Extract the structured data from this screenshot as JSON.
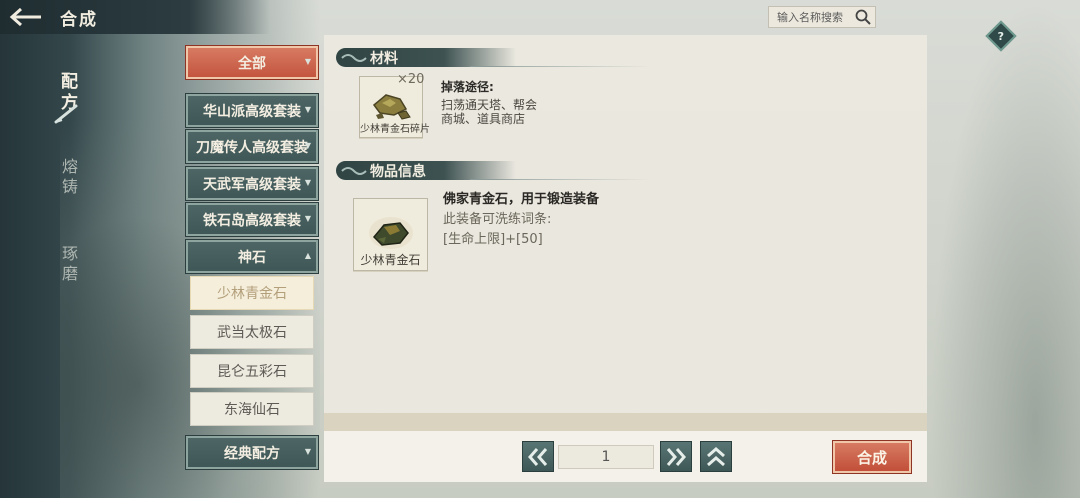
{
  "header": {
    "title": "合成",
    "back_icon": "back-arrow-icon",
    "search_placeholder": "输入名称搜索",
    "help_label": "?"
  },
  "side_tabs": [
    {
      "label": "配方",
      "active": true
    },
    {
      "label": "熔铸",
      "active": false
    },
    {
      "label": "琢磨",
      "active": false
    }
  ],
  "categories": {
    "all": "全部",
    "cat1": "华山派高级套装",
    "cat2": "刀魔传人高级套装",
    "cat3": "天武军高级套装",
    "cat4": "铁石岛高级套装",
    "cat5": "神石",
    "cat6": "经典配方"
  },
  "subitems": [
    "少林青金石",
    "武当太极石",
    "昆仑五彩石",
    "东海仙石"
  ],
  "selected_subitem": "少林青金石",
  "materials": {
    "heading": "材料",
    "item_name": "少林青金石碎片",
    "quantity": "×20",
    "drop_title": "掉落途径:",
    "drop_sources": "扫荡通天塔、帮会商城、道具商店"
  },
  "item_info": {
    "heading": "物品信息",
    "item_name": "少林青金石",
    "description": "佛家青金石，用于锻造装备",
    "refine_note": "此装备可洗练词条:",
    "attribute": "[生命上限]+[50]"
  },
  "pager": {
    "page": "1"
  },
  "actions": {
    "synthesize": "合成"
  },
  "colors": {
    "accent_red": "#c4553f",
    "teal_button": "#4d6665"
  }
}
